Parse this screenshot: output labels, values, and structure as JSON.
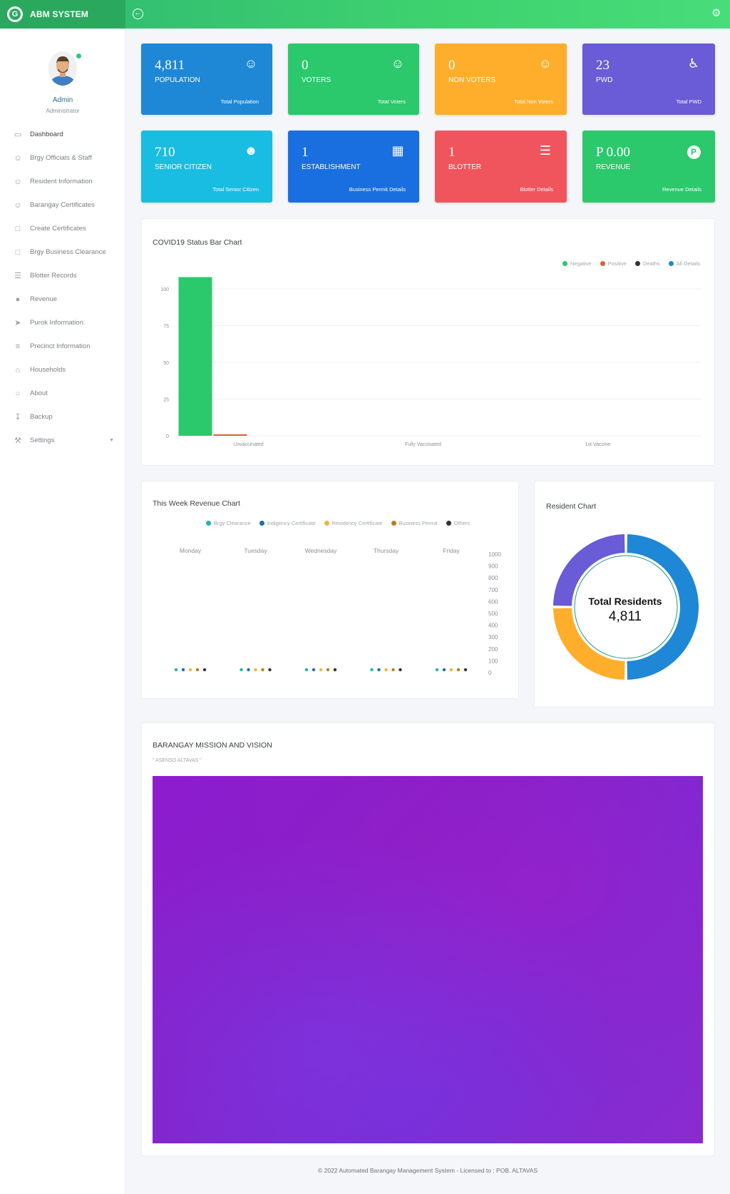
{
  "app": {
    "title": "ABM SYSTEM",
    "logo_letter": "G"
  },
  "user": {
    "name": "Admin",
    "role": "Administrator"
  },
  "sidebar": {
    "items": [
      {
        "label": "Dashboard",
        "icon": "monitor-icon"
      },
      {
        "label": "Brgy Officials & Staff",
        "icon": "user-icon"
      },
      {
        "label": "Resident Information",
        "icon": "users-icon"
      },
      {
        "label": "Barangay Certificates",
        "icon": "users-icon"
      },
      {
        "label": "Create Certificates",
        "icon": "file-icon"
      },
      {
        "label": "Brgy Business Clearance",
        "icon": "file-icon"
      },
      {
        "label": "Blotter Records",
        "icon": "layers-icon"
      },
      {
        "label": "Revenue",
        "icon": "peso-icon"
      },
      {
        "label": "Purok Information",
        "icon": "signpost-icon"
      },
      {
        "label": "Precinct Information",
        "icon": "list-icon"
      },
      {
        "label": "Households",
        "icon": "home-icon"
      },
      {
        "label": "About",
        "icon": "chat-icon"
      },
      {
        "label": "Backup",
        "icon": "download-icon"
      },
      {
        "label": "Settings",
        "icon": "wrench-icon"
      }
    ]
  },
  "cards": [
    {
      "value": "4,811",
      "label": "POPULATION",
      "link": "Total Population",
      "color": "#1e88d6",
      "icon": "user-icon"
    },
    {
      "value": "0",
      "label": "VOTERS",
      "link": "Total Voters",
      "color": "#2bc86c",
      "icon": "user-icon"
    },
    {
      "value": "0",
      "label": "NON VOTERS",
      "link": "Total Non Voters",
      "color": "#ffae2b",
      "icon": "user-icon"
    },
    {
      "value": "23",
      "label": "PWD",
      "link": "Total PWD",
      "color": "#6a5bd6",
      "icon": "wheelchair-icon"
    },
    {
      "value": "710",
      "label": "SENIOR CITIZEN",
      "link": "Total Senior Citizen",
      "color": "#19bde2",
      "icon": "group-icon"
    },
    {
      "value": "1",
      "label": "ESTABLISHMENT",
      "link": "Business Permit Details",
      "color": "#1a6fe0",
      "icon": "building-icon"
    },
    {
      "value": "1",
      "label": "BLOTTER",
      "link": "Blotter Details",
      "color": "#f0555e",
      "icon": "layers-icon"
    },
    {
      "value": "P 0.00",
      "label": "REVENUE",
      "link": "Revenue Details",
      "color": "#2bc86c",
      "icon": "peso-icon"
    }
  ],
  "covid_panel": {
    "title": "COVID19 Status Bar Chart"
  },
  "revenue_panel": {
    "title": "This Week Revenue Chart"
  },
  "resident_panel": {
    "title": "Resident Chart",
    "center_label": "Total Residents",
    "center_value": "4,811"
  },
  "mission_panel": {
    "title": "BARANGAY MISSION AND VISION",
    "subtitle": "\" ASENSO ALTAVAS \""
  },
  "footer": {
    "text": "© 2022 Automated Barangay Management System - Licensed to : POB. ALTAVAS"
  },
  "chart_data": [
    {
      "type": "bar",
      "title": "COVID19 Status Bar Chart",
      "categories": [
        "Unvaccinated",
        "Fully Vaccinated",
        "1st Vaccine"
      ],
      "ylim": [
        0,
        100
      ],
      "yticks": [
        0,
        25,
        50,
        75,
        100
      ],
      "legend_position": "top-right",
      "series": [
        {
          "name": "Negative",
          "color": "#2bc86c",
          "values": [
            108,
            0,
            0
          ]
        },
        {
          "name": "Positive",
          "color": "#e0603a",
          "values": [
            1,
            0,
            0
          ]
        },
        {
          "name": "Deaths",
          "color": "#333333",
          "values": [
            0,
            0,
            0
          ]
        },
        {
          "name": "All Details",
          "color": "#1e88d6",
          "values": [
            0,
            0,
            0
          ]
        }
      ]
    },
    {
      "type": "scatter",
      "title": "This Week Revenue Chart",
      "categories": [
        "Monday",
        "Tuesday",
        "Wednesday",
        "Thursday",
        "Friday"
      ],
      "ylim": [
        0,
        1000
      ],
      "yticks": [
        1000,
        900,
        800,
        700,
        600,
        500,
        400,
        300,
        200,
        100,
        0
      ],
      "legend_position": "top",
      "series": [
        {
          "name": "Brgy Clearance",
          "color": "#1fb5b0",
          "values": [
            0,
            0,
            0,
            0,
            0
          ]
        },
        {
          "name": "Indigency Certificate",
          "color": "#1b6fa8",
          "values": [
            0,
            0,
            0,
            0,
            0
          ]
        },
        {
          "name": "Residency Certificate",
          "color": "#f4b23e",
          "values": [
            0,
            0,
            0,
            0,
            0
          ]
        },
        {
          "name": "Business Permit",
          "color": "#c07a1a",
          "values": [
            0,
            0,
            0,
            0,
            0
          ]
        },
        {
          "name": "Others",
          "color": "#333333",
          "values": [
            0,
            0,
            0,
            0,
            0
          ]
        }
      ]
    },
    {
      "type": "pie",
      "title": "Resident Chart",
      "slices": [
        {
          "value": 50,
          "color": "#1e88d6"
        },
        {
          "value": 25,
          "color": "#ffae2b"
        },
        {
          "value": 25,
          "color": "#6a5bd6"
        }
      ]
    }
  ]
}
